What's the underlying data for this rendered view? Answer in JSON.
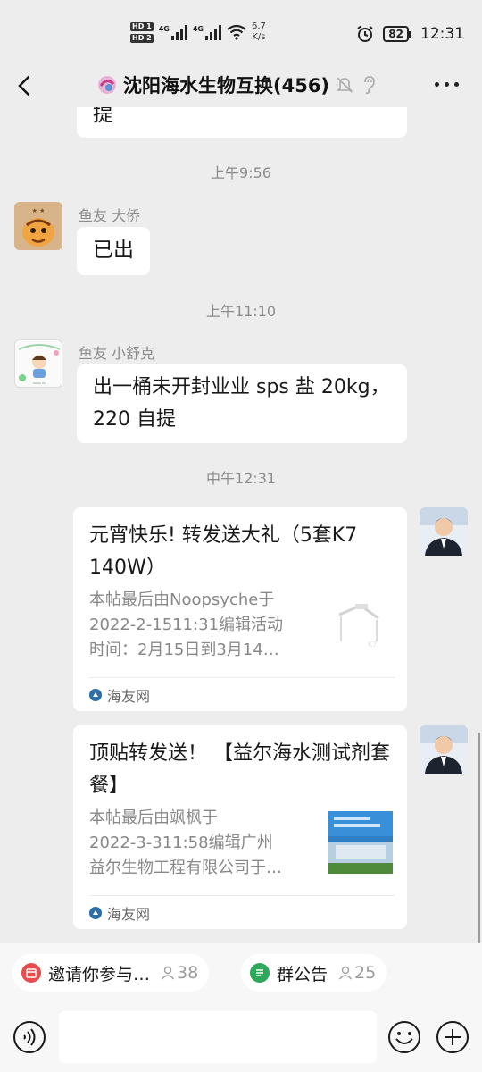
{
  "status_bar": {
    "hd1": "HD 1",
    "hd2": "HD 2",
    "net1": "4G",
    "net2": "4G",
    "speed_value": "6.7",
    "speed_unit": "K/s",
    "battery": "82",
    "time": "12:31"
  },
  "header": {
    "title": "沈阳海水生物互换(456)"
  },
  "chat": {
    "prev_bubble_tail": "提",
    "messages": [
      {
        "time": "上午9:56",
        "sender": "鱼友 大侨",
        "text": "已出"
      },
      {
        "time": "上午11:10",
        "sender": "鱼友 小舒克",
        "text_line1": "出一桶未开封业业 sps 盐 20kg，",
        "text_line2": "220 自提"
      }
    ],
    "time_3": "中午12:31",
    "cards": [
      {
        "title": "元宵快乐! 转发送大礼（5套K7 140W）",
        "desc_line1": "本帖最后由Noopsyche于",
        "desc_line2": "2022-2-1511:31编辑活动",
        "desc_line3": "时间：2月15日到3月14…",
        "source": "海友网"
      },
      {
        "title": "顶贴转发送！ 【益尔海水测试剂套餐】",
        "desc_line1": "本帖最后由飒枫于",
        "desc_line2": "2022-3-311:58编辑广州",
        "desc_line3": "益尔生物工程有限公司于…",
        "source": "海友网"
      }
    ]
  },
  "chips": [
    {
      "label": "邀请你参与…",
      "count": "38",
      "color": "#e84c4c"
    },
    {
      "label": "群公告",
      "count": "25",
      "color": "#2fa75a"
    }
  ]
}
